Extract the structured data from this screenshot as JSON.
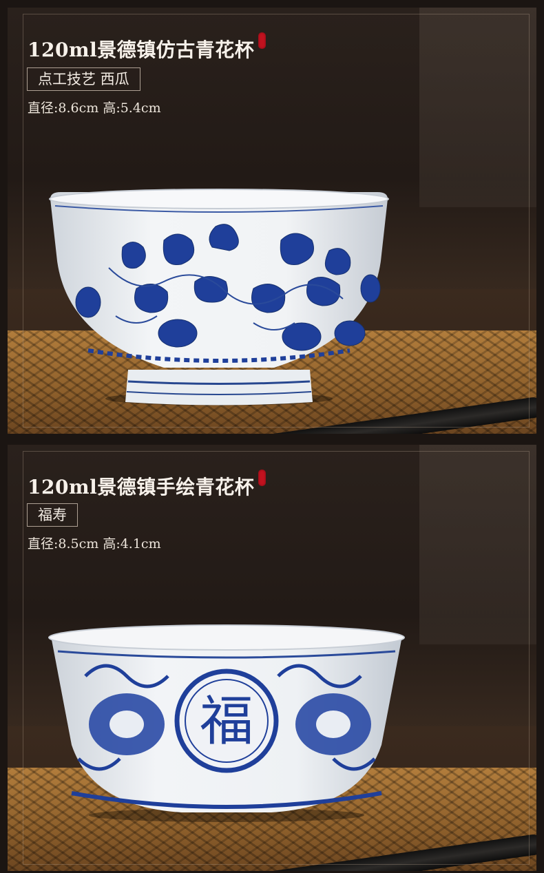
{
  "products": [
    {
      "title": "120ml景德镇仿古青花杯",
      "tag": "点工技艺 西瓜",
      "dimensions": "直径:8.6cm 高:5.4cm"
    },
    {
      "title": "120ml景德镇手绘青花杯",
      "tag": "福寿",
      "dimensions": "直径:8.5cm 高:4.1cm",
      "center_character": "福"
    }
  ],
  "colors": {
    "background": "#1b1512",
    "seal_red": "#c1121f",
    "porcelain_blue": "#1f3f9a",
    "porcelain_white": "#eef0f4"
  }
}
